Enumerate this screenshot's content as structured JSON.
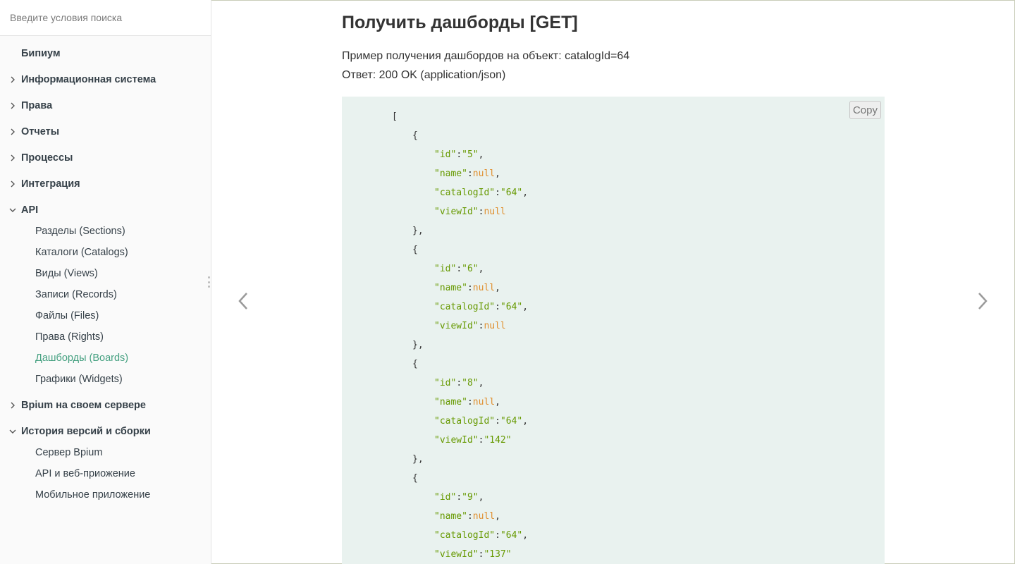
{
  "search": {
    "placeholder": "Введите условия поиска"
  },
  "sidebar": {
    "items": [
      {
        "label": "Бипиум",
        "chevron": "none"
      },
      {
        "label": "Информационная система",
        "chevron": "right"
      },
      {
        "label": "Права",
        "chevron": "right"
      },
      {
        "label": "Отчеты",
        "chevron": "right"
      },
      {
        "label": "Процессы",
        "chevron": "right"
      },
      {
        "label": "Интеграция",
        "chevron": "right"
      },
      {
        "label": "API",
        "chevron": "down"
      },
      {
        "label": "Разделы (Sections)",
        "sub": true
      },
      {
        "label": "Каталоги (Catalogs)",
        "sub": true
      },
      {
        "label": "Виды (Views)",
        "sub": true
      },
      {
        "label": "Записи (Records)",
        "sub": true
      },
      {
        "label": "Файлы (Files)",
        "sub": true
      },
      {
        "label": "Права (Rights)",
        "sub": true
      },
      {
        "label": "Дашборды (Boards)",
        "sub": true,
        "active": true
      },
      {
        "label": "Графики (Widgets)",
        "sub": true
      },
      {
        "label": "Bpium на своем сервере",
        "chevron": "right"
      },
      {
        "label": "История версий и сборки",
        "chevron": "down"
      },
      {
        "label": "Сервер Bpium",
        "sub": true
      },
      {
        "label": "API и веб-приожение",
        "sub": true
      },
      {
        "label": "Мобильное приложение",
        "sub": true
      }
    ]
  },
  "main": {
    "title": "Получить дашборды [GET]",
    "paragraph1": "Пример получения дашбордов на объект: catalogId=64",
    "paragraph2": "Ответ: 200 OK (application/json)",
    "copy_label": "Copy",
    "code": [
      {
        "indent": 0,
        "text": "["
      },
      {
        "indent": 1,
        "text": "{"
      },
      {
        "indent": 2,
        "key": "\"id\"",
        "value": "\"5\"",
        "vtype": "str",
        "comma": true
      },
      {
        "indent": 2,
        "key": "\"name\"",
        "value": "null",
        "vtype": "null",
        "comma": true
      },
      {
        "indent": 2,
        "key": "\"catalogId\"",
        "value": "\"64\"",
        "vtype": "str",
        "comma": true
      },
      {
        "indent": 2,
        "key": "\"viewId\"",
        "value": "null",
        "vtype": "null",
        "comma": false
      },
      {
        "indent": 1,
        "text": "},"
      },
      {
        "indent": 1,
        "text": "{"
      },
      {
        "indent": 2,
        "key": "\"id\"",
        "value": "\"6\"",
        "vtype": "str",
        "comma": true
      },
      {
        "indent": 2,
        "key": "\"name\"",
        "value": "null",
        "vtype": "null",
        "comma": true
      },
      {
        "indent": 2,
        "key": "\"catalogId\"",
        "value": "\"64\"",
        "vtype": "str",
        "comma": true
      },
      {
        "indent": 2,
        "key": "\"viewId\"",
        "value": "null",
        "vtype": "null",
        "comma": false
      },
      {
        "indent": 1,
        "text": "},"
      },
      {
        "indent": 1,
        "text": "{"
      },
      {
        "indent": 2,
        "key": "\"id\"",
        "value": "\"8\"",
        "vtype": "str",
        "comma": true
      },
      {
        "indent": 2,
        "key": "\"name\"",
        "value": "null",
        "vtype": "null",
        "comma": true
      },
      {
        "indent": 2,
        "key": "\"catalogId\"",
        "value": "\"64\"",
        "vtype": "str",
        "comma": true
      },
      {
        "indent": 2,
        "key": "\"viewId\"",
        "value": "\"142\"",
        "vtype": "str",
        "comma": false
      },
      {
        "indent": 1,
        "text": "},"
      },
      {
        "indent": 1,
        "text": "{"
      },
      {
        "indent": 2,
        "key": "\"id\"",
        "value": "\"9\"",
        "vtype": "str",
        "comma": true
      },
      {
        "indent": 2,
        "key": "\"name\"",
        "value": "null",
        "vtype": "null",
        "comma": true
      },
      {
        "indent": 2,
        "key": "\"catalogId\"",
        "value": "\"64\"",
        "vtype": "str",
        "comma": true
      },
      {
        "indent": 2,
        "key": "\"viewId\"",
        "value": "\"137\"",
        "vtype": "str",
        "comma": false
      }
    ]
  },
  "icons": {
    "prev": "chevron-left-icon",
    "next": "chevron-right-icon",
    "collapsed": "chevron-right-icon",
    "expanded": "chevron-down-icon"
  },
  "colors": {
    "accent": "#44a080",
    "code_bg": "#e9f2ef",
    "string": "#669900",
    "null": "#e08f2e"
  }
}
